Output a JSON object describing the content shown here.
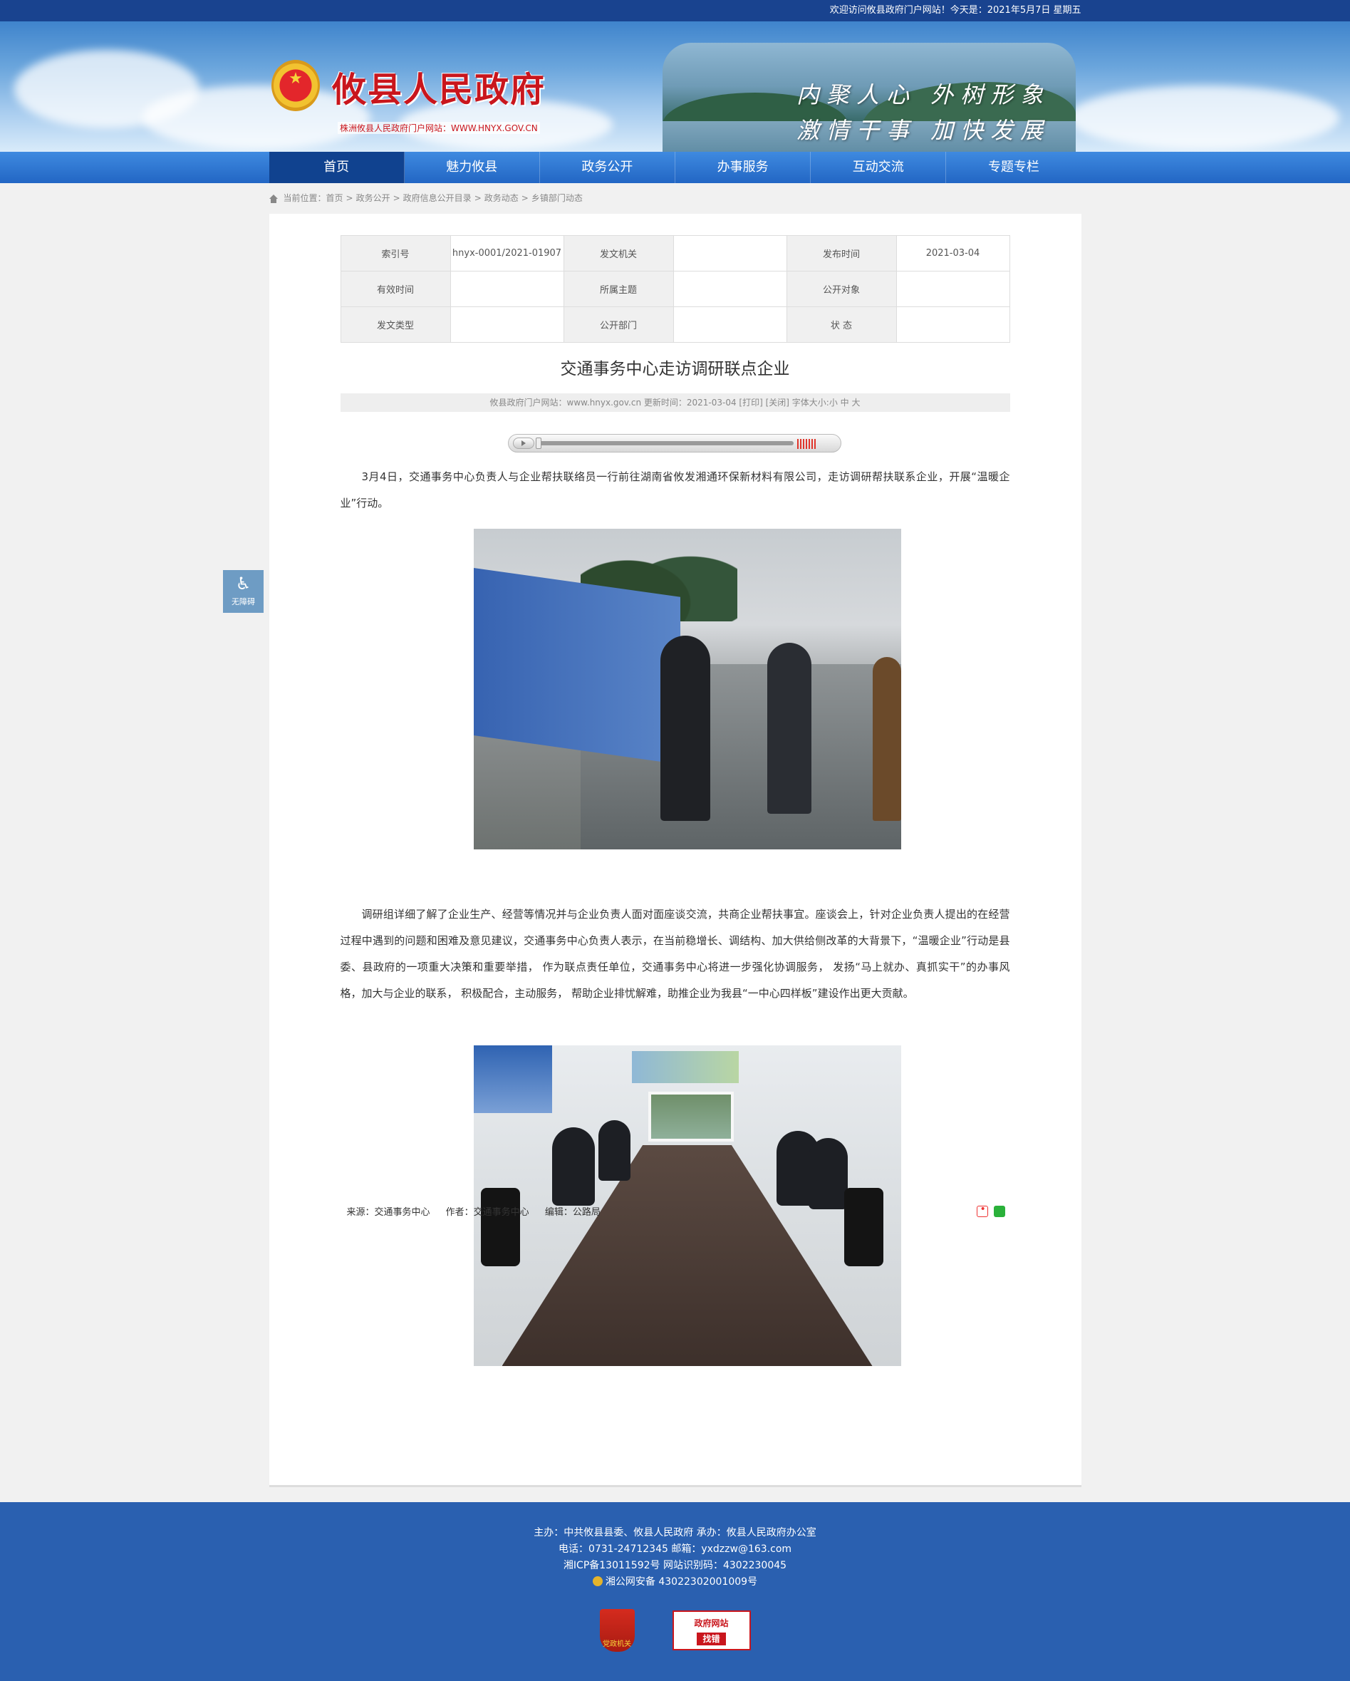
{
  "topbar": {
    "welcome": "欢迎访问攸县政府门户网站！今天是：2021年5月7日 星期五"
  },
  "header": {
    "site_name": "攸县人民政府",
    "site_url": "株洲攸县人民政府门户网站：WWW.HNYX.GOV.CN",
    "slogan_line1": "内聚人心 外树形象",
    "slogan_line2": "激情干事 加快发展"
  },
  "nav": {
    "items": [
      "首页",
      "魅力攸县",
      "政务公开",
      "办事服务",
      "互动交流",
      "专题专栏"
    ],
    "active": 0
  },
  "breadcrumb": {
    "label": "当前位置：",
    "items": [
      "首页",
      "政务公开",
      "政府信息公开目录",
      "政务动态",
      "乡镇部门动态"
    ]
  },
  "meta": {
    "rows": [
      [
        {
          "k": "索引号",
          "v": "hnyx-0001/2021-01907"
        },
        {
          "k": "发文机关",
          "v": ""
        },
        {
          "k": "发布时间",
          "v": "2021-03-04"
        }
      ],
      [
        {
          "k": "有效时间",
          "v": ""
        },
        {
          "k": "所属主题",
          "v": ""
        },
        {
          "k": "公开对象",
          "v": ""
        }
      ],
      [
        {
          "k": "发文类型",
          "v": ""
        },
        {
          "k": "公开部门",
          "v": ""
        },
        {
          "k": "状 态",
          "v": ""
        }
      ]
    ]
  },
  "article": {
    "title": "交通事务中心走访调研联点企业",
    "info": "攸县政府门户网站：www.hnyx.gov.cn  更新时间：2021-03-04  [打印] [关闭]  字体大小:小 中 大",
    "para1": "3月4日，交通事务中心负责人与企业帮扶联络员一行前往湖南省攸发湘通环保新材料有限公司，走访调研帮扶联系企业，开展“温暖企业”行动。",
    "para2": "调研组详细了解了企业生产、经营等情况并与企业负责人面对面座谈交流，共商企业帮扶事宜。座谈会上，针对企业负责人提出的在经营过程中遇到的问题和困难及意见建议，交通事务中心负责人表示，在当前稳增长、调结构、加大供给侧改革的大背景下，“温暖企业”行动是县委、县政府的一项重大决策和重要举措， 作为联点责任单位，交通事务中心将进一步强化协调服务， 发扬“马上就办、真抓实干”的办事风格，加大与企业的联系， 积极配合，主动服务， 帮助企业排忧解难，助推企业为我县“一中心四样板”建设作出更大贡献。",
    "source": "来源：交通事务中心",
    "author": "作者：交通事务中心",
    "editor": "编辑：公路局"
  },
  "accessibility": {
    "label": "无障碍"
  },
  "footer": {
    "line1": "主办：中共攸县县委、攸县人民政府 承办：攸县人民政府办公室",
    "line2": "电话：0731-24712345 邮箱：yxdzzw@163.com",
    "line3": "湘ICP备13011592号    网站识别码：4302230045",
    "line4": "湘公网安备 43022302001009号",
    "party_badge": "党政机关",
    "gov_badge_title": "政府网站",
    "gov_badge_sub": "找错"
  },
  "colors": {
    "nav_active": "#10428f",
    "footer_bg": "#2a60b0",
    "brand_red": "#c9161d"
  }
}
